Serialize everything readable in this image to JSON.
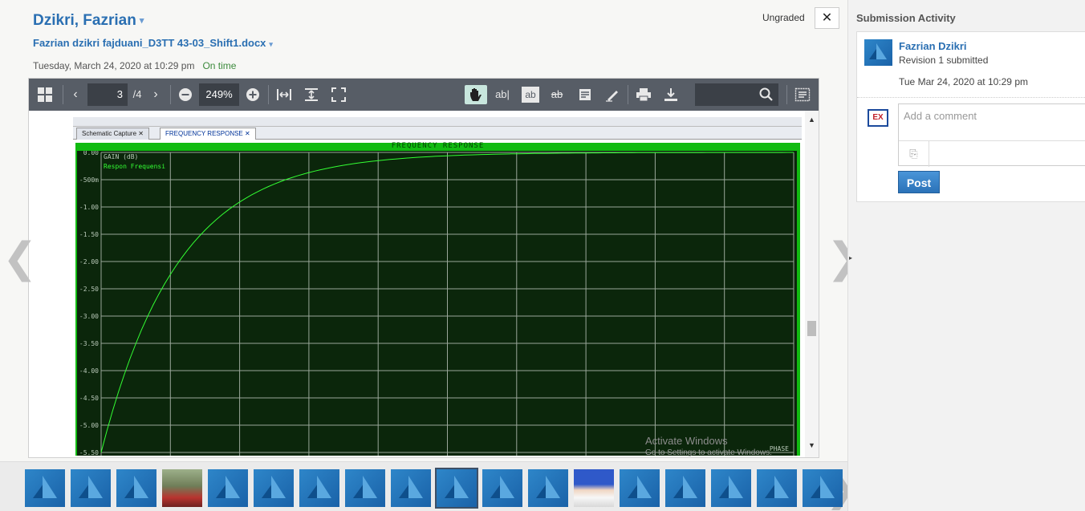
{
  "header": {
    "student_name": "Dzikri, Fazrian",
    "file_name": "Fazrian dzikri fajduani_D3TT 43-03_Shift1.docx",
    "submitted_date": "Tuesday, March 24, 2020 at 10:29 pm",
    "on_time": "On time",
    "grade_status": "Ungraded",
    "close_symbol": "✕",
    "caret": "▾"
  },
  "toolbar": {
    "page_current": "3",
    "page_total": "/4",
    "zoom": "249%",
    "search_value": "",
    "icons": [
      "thumbnails-icon",
      "prev-page-icon",
      "next-page-icon",
      "zoom-out-icon",
      "zoom-in-icon",
      "fit-width-icon",
      "fit-height-icon",
      "fullscreen-icon",
      "pan-icon",
      "text-select-icon",
      "highlight-text-icon",
      "strikethrough-icon",
      "note-icon",
      "draw-icon",
      "print-icon",
      "download-icon",
      "search-icon",
      "annotations-panel-icon"
    ]
  },
  "document": {
    "window_tabs": [
      "Schematic Capture",
      "FREQUENCY RESPONSE"
    ],
    "plot_header": "FREQUENCY  RESPONSE",
    "gain_label": "GAIN (dB)",
    "series_label": "Respon Frequensi",
    "phase_label": "PHASE",
    "y_ticks": [
      "0.00",
      "-500m",
      "-1.00",
      "-1.50",
      "-2.00",
      "-2.50",
      "-3.00",
      "-3.50",
      "-4.00",
      "-4.50",
      "-5.00",
      "-5.50"
    ],
    "watermark_line1": "Activate Windows",
    "watermark_line2": "Go to Settings to activate Windows."
  },
  "nav": {
    "prev_arrow": "❮",
    "next_arrow": "❯"
  },
  "thumbnails": {
    "count": 18,
    "selected_index": 9,
    "photo_indices": [
      3,
      12
    ],
    "next_arrow": "❯"
  },
  "sidebar": {
    "title": "Submission Activity",
    "toggle": "▸",
    "activity": {
      "name": "Fazrian Dzikri",
      "status": "Revision 1 submitted",
      "time": "Tue Mar 24, 2020 at 10:29 pm"
    },
    "comment_placeholder": "Add a comment",
    "post_label": "Post"
  },
  "colors": {
    "link_blue": "#2a6fb2",
    "plot_bg": "#0b260b",
    "plot_curve": "#33ff33",
    "toolbar_bg": "#575d66"
  }
}
